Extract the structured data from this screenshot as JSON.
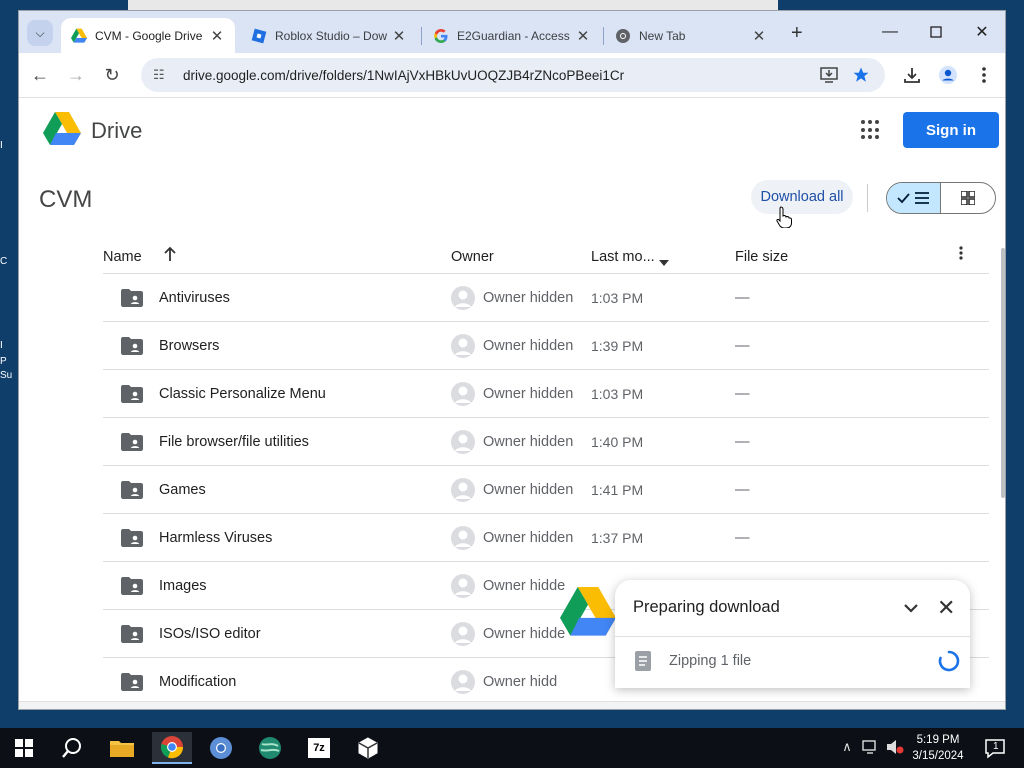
{
  "desktop": {
    "left_labels": [
      "I",
      "C",
      "I",
      "P",
      "Su"
    ]
  },
  "browser": {
    "tabs": [
      {
        "title": "CVM - Google Drive",
        "active": true
      },
      {
        "title": "Roblox Studio – Dow",
        "active": false
      },
      {
        "title": "E2Guardian - Access",
        "active": false
      },
      {
        "title": "New Tab",
        "active": false
      }
    ],
    "new_tab_label": "+",
    "url": "drive.google.com/drive/folders/1NwIAjVxHBkUvUOQZJB4rZNcoPBeei1Cr"
  },
  "drive": {
    "brand": "Drive",
    "sign_in_label": "Sign in",
    "folder_title": "CVM",
    "download_all_label": "Download all",
    "columns": {
      "name": "Name",
      "owner": "Owner",
      "last_modified": "Last mo...",
      "file_size": "File size"
    },
    "rows": [
      {
        "name": "Antiviruses",
        "owner": "Owner hidden",
        "modified": "1:03 PM",
        "size": "—"
      },
      {
        "name": "Browsers",
        "owner": "Owner hidden",
        "modified": "1:39 PM",
        "size": "—"
      },
      {
        "name": "Classic Personalize Menu",
        "owner": "Owner hidden",
        "modified": "1:03 PM",
        "size": "—"
      },
      {
        "name": "File browser/file utilities",
        "owner": "Owner hidden",
        "modified": "1:40 PM",
        "size": "—"
      },
      {
        "name": "Games",
        "owner": "Owner hidden",
        "modified": "1:41 PM",
        "size": "—"
      },
      {
        "name": "Harmless Viruses",
        "owner": "Owner hidden",
        "modified": "1:37 PM",
        "size": "—"
      },
      {
        "name": "Images",
        "owner": "Owner hidde",
        "modified": "",
        "size": ""
      },
      {
        "name": "ISOs/ISO editor",
        "owner": "Owner hidde",
        "modified": "",
        "size": ""
      },
      {
        "name": "Modification",
        "owner": "Owner hidd",
        "modified": "",
        "size": ""
      }
    ]
  },
  "download_panel": {
    "title": "Preparing download",
    "status": "Zipping 1 file"
  },
  "taskbar": {
    "time": "5:19 PM",
    "date": "3/15/2024",
    "notification_count": "1",
    "sevenzip_label": "7z"
  },
  "colors": {
    "accent": "#1a73e8",
    "tabstrip": "#dbe4f5",
    "omnibox": "#e9eef6",
    "selected_toggle": "#c2e7ff"
  }
}
